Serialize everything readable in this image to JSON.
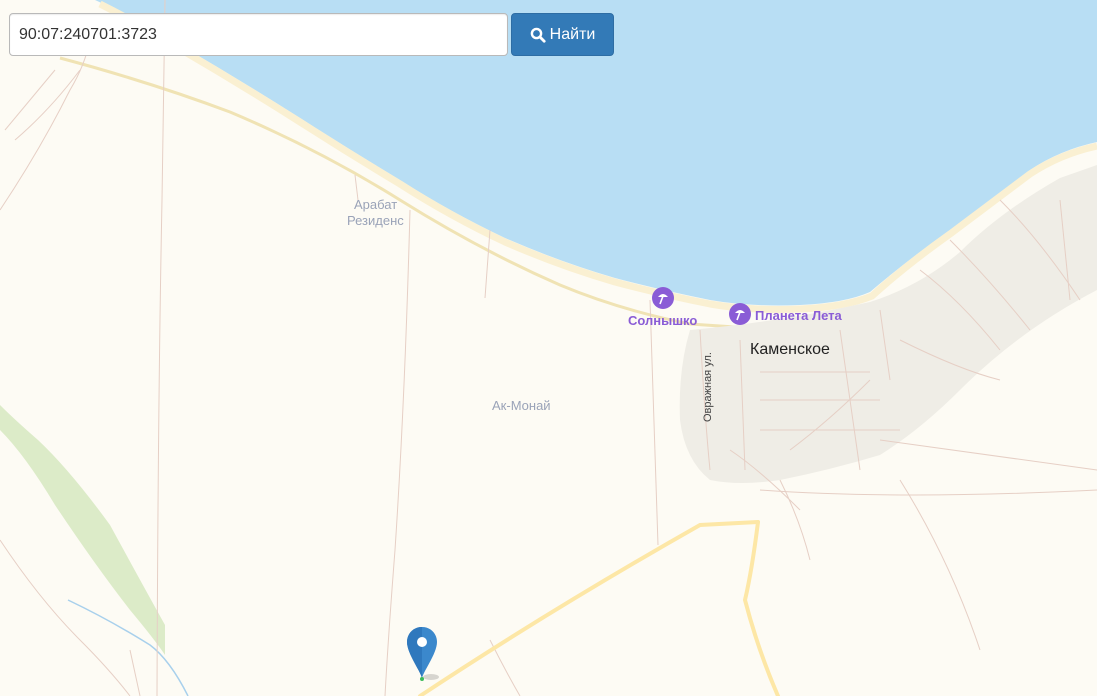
{
  "search": {
    "value": "90:07:240701:3723",
    "button_label": "Найти",
    "button_icon": "search-icon"
  },
  "map": {
    "colors": {
      "water": "#b8def4",
      "land": "#fdfbf4",
      "beach": "#faf0d2",
      "settlement": "#efede6",
      "field_green": "#dcebc8",
      "major_road": "#fde7a6",
      "minor_road": "#e6cfc5",
      "poi_purple": "#8a5cd6",
      "marker_blue": "#3b88cc"
    },
    "labels": {
      "arabat_line1": "Арабат",
      "arabat_line2": "Резиденс",
      "ak_monai": "Ак-Монай",
      "kamenskoe": "Каменское",
      "street": "Овражная ул.",
      "poi_solnyshko": "Солнышко",
      "poi_planeta": "Планета Лета"
    },
    "marker_icon": "map-marker-icon",
    "poi_icon": "beach-umbrella-icon"
  }
}
